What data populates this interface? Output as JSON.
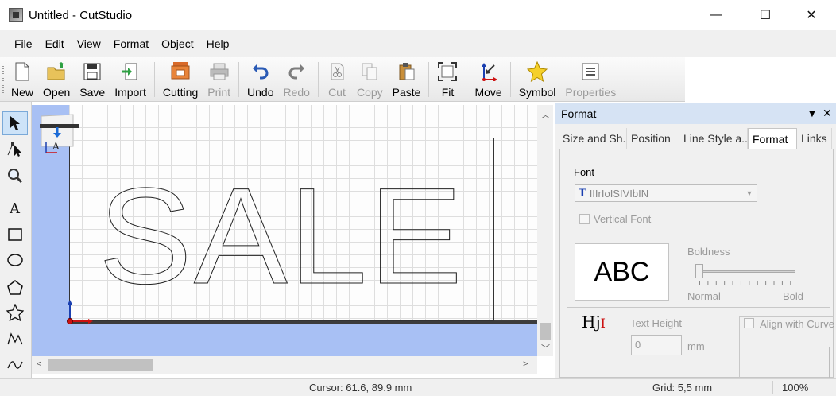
{
  "window": {
    "title": "Untitled - CutStudio",
    "minimize_glyph": "—",
    "maximize_glyph": "☐",
    "close_glyph": "✕"
  },
  "menu": [
    "File",
    "Edit",
    "View",
    "Format",
    "Object",
    "Help"
  ],
  "toolbar": {
    "new": "New",
    "open": "Open",
    "save": "Save",
    "import": "Import",
    "cutting": "Cutting",
    "print": "Print",
    "undo": "Undo",
    "redo": "Redo",
    "cut": "Cut",
    "copy": "Copy",
    "paste": "Paste",
    "fit": "Fit",
    "move": "Move",
    "symbol": "Symbol",
    "properties": "Properties"
  },
  "canvas": {
    "text": "SALE",
    "origin_label": "A"
  },
  "panel": {
    "title": "Format",
    "tabs": [
      "Size and Sh...",
      "Position",
      "Line Style a...",
      "Format",
      "Links"
    ],
    "active_tab": "Format",
    "font_label": "Font",
    "font_value": "IIIrIoISIVIbIN",
    "vertical_font": "Vertical Font",
    "preview_text": "ABC",
    "boldness_label": "Boldness",
    "boldness_normal": "Normal",
    "boldness_bold": "Bold",
    "hj_glyph": "Hj",
    "text_height_label": "Text Height",
    "text_height_value": "0",
    "text_height_unit": "mm",
    "align_with_curve": "Align with Curve"
  },
  "status": {
    "cursor": "Cursor: 61.6, 89.9 mm",
    "grid": "Grid: 5,5 mm",
    "zoom": "100%"
  },
  "colors": {
    "canvas_background": "#a8c0f4",
    "panel_header": "#d6e3f4",
    "origin_x": "#cc1111",
    "origin_y": "#1a3fb0"
  }
}
